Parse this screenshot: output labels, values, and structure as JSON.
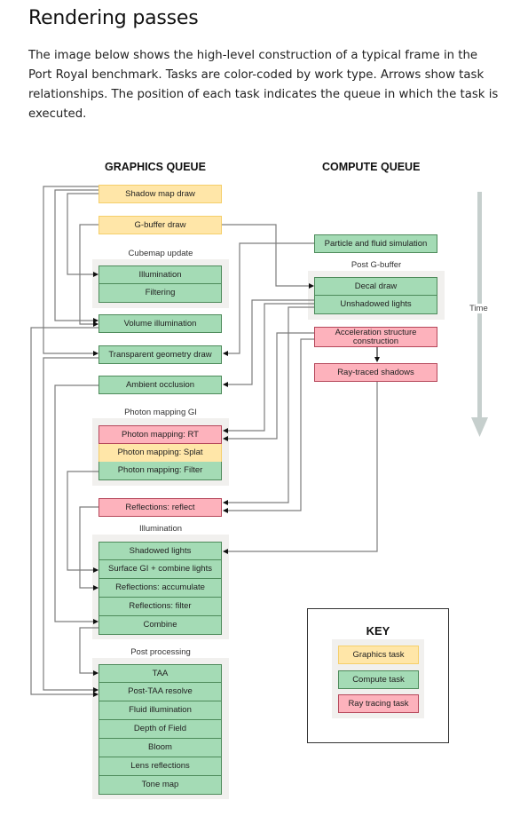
{
  "page": {
    "title": "Rendering passes",
    "intro": "The image below shows the high-level construction of a typical frame in the Port Royal benchmark. Tasks are color-coded by work type. Arrows show task relationships. The position of each task indicates the queue in which the task is executed."
  },
  "colors": {
    "graphics_fill": "#ffe6a8",
    "compute_fill": "#a4dbb5",
    "raytracing_fill": "#fdb2bc",
    "group_bg": "#f1f0ee",
    "time_arrow": "#c6cfcd"
  },
  "queues": {
    "graphics": "GRAPHICS QUEUE",
    "compute": "COMPUTE QUEUE"
  },
  "graphics_tasks": {
    "shadow_map_draw": "Shadow map draw",
    "gbuffer_draw": "G-buffer draw",
    "cubemap_group": "Cubemap update",
    "cubemap_illumination": "Illumination",
    "cubemap_filtering": "Filtering",
    "volume_illumination": "Volume illumination",
    "transparent_geometry_draw": "Transparent geometry draw",
    "ambient_occlusion": "Ambient occlusion",
    "photon_group": "Photon mapping GI",
    "photon_rt": "Photon mapping: RT",
    "photon_splat": "Photon mapping: Splat",
    "photon_filter": "Photon mapping: Filter",
    "reflections_reflect": "Reflections: reflect",
    "illumination_group": "Illumination",
    "shadowed_lights": "Shadowed lights",
    "surface_gi": "Surface GI + combine lights",
    "reflections_accumulate": "Reflections: accumulate",
    "reflections_filter": "Reflections: filter",
    "combine": "Combine",
    "post_group": "Post processing",
    "taa": "TAA",
    "post_taa_resolve": "Post-TAA resolve",
    "fluid_illumination": "Fluid illumination",
    "depth_of_field": "Depth of Field",
    "bloom": "Bloom",
    "lens_reflections": "Lens reflections",
    "tone_map": "Tone map"
  },
  "compute_tasks": {
    "particle_fluid_sim": "Particle and fluid simulation",
    "post_gbuffer_group": "Post G-buffer",
    "decal_draw": "Decal draw",
    "unshadowed_lights": "Unshadowed lights",
    "accel_structure": "Acceleration structure construction",
    "ray_traced_shadows": "Ray-traced shadows"
  },
  "time_axis": {
    "label": "Time"
  },
  "key": {
    "title": "KEY",
    "items": [
      {
        "label": "Graphics task",
        "type": "graphics"
      },
      {
        "label": "Compute task",
        "type": "compute"
      },
      {
        "label": "Ray tracing task",
        "type": "raytracing"
      }
    ]
  }
}
